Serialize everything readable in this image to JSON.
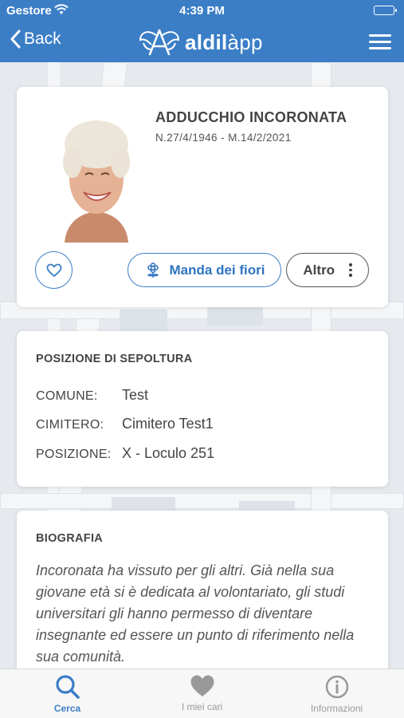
{
  "status_bar": {
    "carrier": "Gestore",
    "time": "4:39 PM"
  },
  "nav": {
    "back_label": "Back",
    "logo_text_bold": "aldil",
    "logo_text_rest": "àpp"
  },
  "profile": {
    "name": "ADDUCCHIO INCORONATA",
    "dates": "N.27/4/1946 - M.14/2/2021",
    "send_flowers_label": "Manda dei fiori",
    "more_label": "Altro"
  },
  "burial": {
    "title": "POSIZIONE DI SEPOLTURA",
    "rows": [
      {
        "label": "COMUNE:",
        "value": "Test"
      },
      {
        "label": "CIMITERO:",
        "value": "Cimitero Test1"
      },
      {
        "label": "POSIZIONE:",
        "value": "X - Loculo 251"
      }
    ]
  },
  "biography": {
    "title": "BIOGRAFIA",
    "text": "Incoronata ha vissuto per gli altri. Già nella sua giovane età si è dedicata al volontariato, gli studi universitari gli hanno permesso di diventare insegnante ed essere un punto di riferimento nella sua comunità."
  },
  "tabs": [
    {
      "label": "Cerca",
      "icon": "search-icon",
      "active": true
    },
    {
      "label": "I miei cari",
      "icon": "heart-icon",
      "active": false
    },
    {
      "label": "Informazioni",
      "icon": "info-icon",
      "active": false
    }
  ],
  "colors": {
    "accent": "#3b7ec6",
    "tab_inactive": "#999999"
  }
}
